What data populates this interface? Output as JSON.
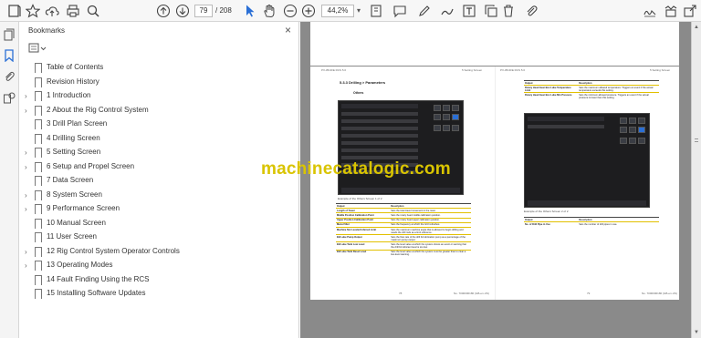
{
  "toolbar": {
    "current_page": "79",
    "total_pages": "/ 208",
    "zoom": "44,2%",
    "zoom_chevron": "▾"
  },
  "bookmarks_panel": {
    "title": "Bookmarks",
    "close": "×",
    "items": [
      {
        "label": "Table of Contents",
        "expandable": false
      },
      {
        "label": "Revision History",
        "expandable": false
      },
      {
        "label": "1 Introduction",
        "expandable": true
      },
      {
        "label": "2 About the Rig Control System",
        "expandable": true
      },
      {
        "label": "3 Drill Plan Screen",
        "expandable": false
      },
      {
        "label": "4 Drilling Screen",
        "expandable": false
      },
      {
        "label": "5 Setting Screen",
        "expandable": true
      },
      {
        "label": "6 Setup and Propel Screen",
        "expandable": true
      },
      {
        "label": "7 Data Screen",
        "expandable": false
      },
      {
        "label": "8 System Screen",
        "expandable": true
      },
      {
        "label": "9 Performance Screen",
        "expandable": true
      },
      {
        "label": "10 Manual Screen",
        "expandable": false
      },
      {
        "label": "11 User Screen",
        "expandable": false
      },
      {
        "label": "12 Rig Control System Operator Controls",
        "expandable": true
      },
      {
        "label": "13 Operating Modes",
        "expandable": true
      },
      {
        "label": "14 Fault Finding Using the RCS",
        "expandable": false
      },
      {
        "label": "15 Installing Software Updates",
        "expandable": false
      }
    ]
  },
  "document": {
    "watermark": "machinecatalogic.com",
    "left_page": {
      "header_left": "PV-351D/E RCS 5.0",
      "header_right": "5 Setting Screen",
      "section_title": "5.3.3 Drilling > Parameters",
      "subsection": "Others",
      "caption": "Example of the Others Screen 1 of 2",
      "table_head": [
        "Output",
        "Description"
      ],
      "table_rows": [
        [
          "Length of Tower",
          "Sets the total travel movement in the mast."
        ],
        [
          "Middle Position Calibration Point",
          "Sets the rotary head middle calibration position."
        ],
        [
          "Upper Position Calibration Point",
          "Sets the rotary head upper calibration position."
        ],
        [
          "Menu Filter",
          "Sets the frequency at which the GUI refreshes."
        ],
        [
          "Machine Not Leveled Inferred Limit",
          "Sets the maximum machine angle that is allowed to begin drilling and needs the drill rods as a limit reference."
        ],
        [
          "EB Lube Pump Output",
          "Sets the flow rate of the drill bit lubrication pump as a percentage of the maximum pump output."
        ],
        [
          "EB Lube Tank Low Level",
          "Sets the level value at which the system shows an event or warning that the drill bit lubricant level is too low."
        ],
        [
          "EB Lube Tank Reset Level",
          "Sets the level value at which the system must be greater than to clear a low-level warning."
        ]
      ],
      "footer_left": "78",
      "footer_right": "No. 7000000180 (GB-en-US)"
    },
    "right_page": {
      "header_left": "PV-351D/E RCS 5.0",
      "header_right": "5 Setting Screen",
      "table_head": [
        "Output",
        "Description"
      ],
      "table_rows": [
        [
          "Rotary Head Gear Box Lube Temperature Limit",
          "Sets the maximum allowed temperature. Triggers an event if the actual temperature exceeds this setting."
        ],
        [
          "Rotary Head Gear Box Lube Min Pressure",
          "Sets the minimum allowed pressure. Triggers an event if the actual pressure is lower than this setting."
        ]
      ],
      "caption": "Example of the Others Screen 2 of 2",
      "table2_head": [
        "Output",
        "Description"
      ],
      "table2_rows": [
        [
          "No. of Drill Pipe in Use",
          "Sets the number of drill pipes in use."
        ]
      ],
      "footer_left": "79",
      "footer_right": "No. 7000000180 (GB-en-US)"
    }
  }
}
